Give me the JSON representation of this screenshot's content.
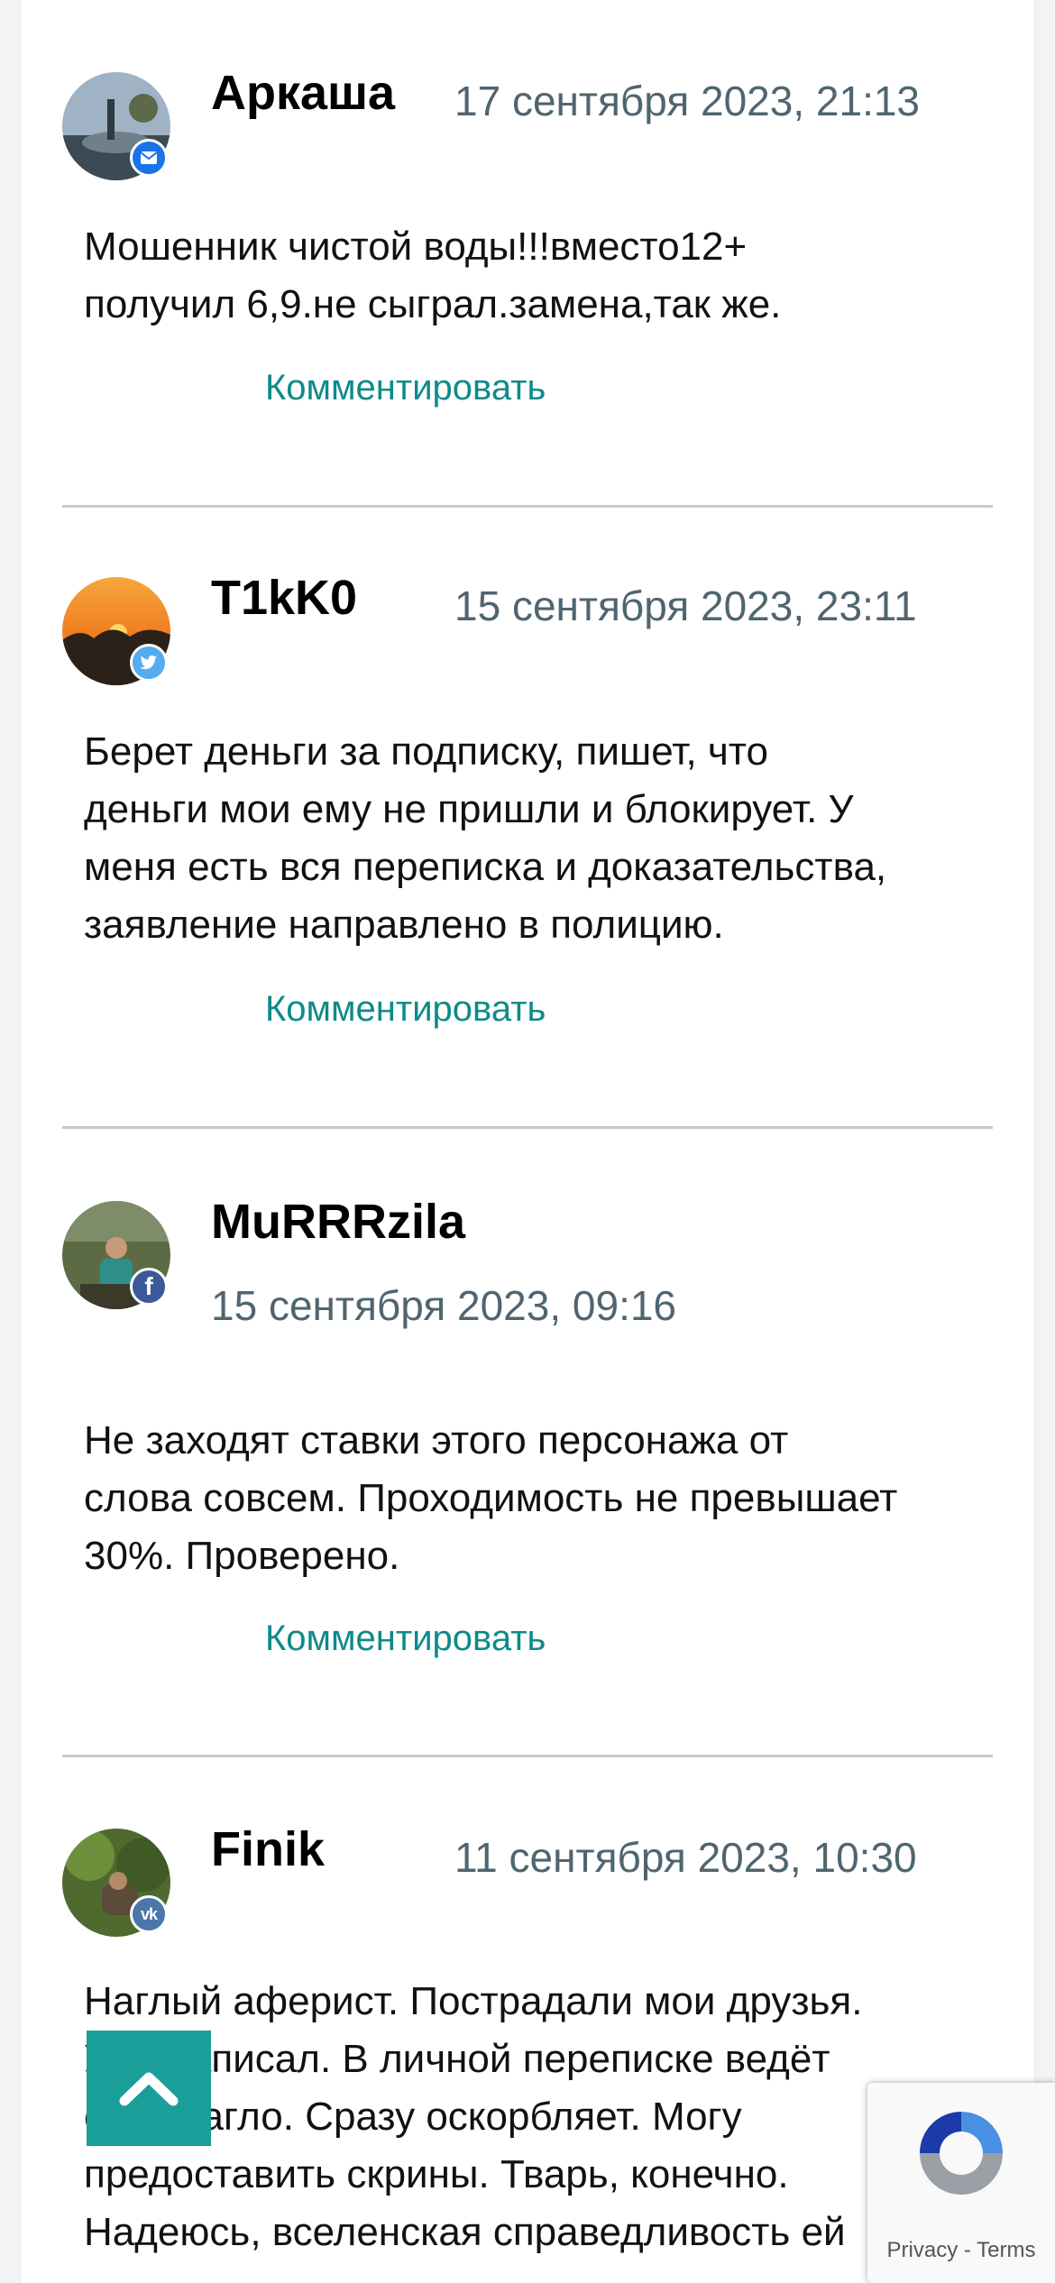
{
  "comments": [
    {
      "author": "Аркаша",
      "date": "17 сентября 2023, 21:13",
      "network": "mail",
      "network_color": "#1a73e8",
      "text_lines": [
        "Мошенник чистой воды!!!вместо12+",
        "получил 6,9.не сыграл.замена,так же."
      ],
      "reply_label": "Комментировать"
    },
    {
      "author": "T1kK0",
      "date": "15 сентября 2023, 23:11",
      "network": "twitter",
      "network_color": "#55acee",
      "text_lines": [
        "Берет деньги за подписку, пишет, что",
        "деньги мои ему не пришли и блокирует. У",
        "меня есть вся переписка и доказательства,",
        "заявление направлено в полицию."
      ],
      "reply_label": "Комментировать"
    },
    {
      "author": "MuRRRzila",
      "date": "15 сентября 2023, 09:16",
      "network": "facebook",
      "network_color": "#3b5998",
      "text_lines": [
        "Не заходят ставки этого персонажа от",
        "слова совсем. Проходимость не превышает",
        "30%. Проверено."
      ],
      "reply_label": "Комментировать"
    },
    {
      "author": "Finik",
      "date": "11 сентября 2023, 10:30",
      "network": "vk",
      "network_color": "#4a76a8",
      "text_lines": [
        "Наглый аферист. Пострадали мои друзья.",
        "Уже написал. В личной переписке ведёт",
        "себя нагло. Сразу оскорбляет. Могу",
        "предоставить скрины. Тварь, конечно.",
        "Надеюсь, вселенская справедливость ей"
      ],
      "reply_label": ""
    }
  ],
  "recaptcha": {
    "privacy": "Privacy",
    "separator": "-",
    "terms": "Terms"
  },
  "colors": {
    "accent": "#0e8a8a",
    "date": "#4f6570",
    "scroll_button": "#1a9e9a",
    "divider": "#c9c9c9"
  }
}
